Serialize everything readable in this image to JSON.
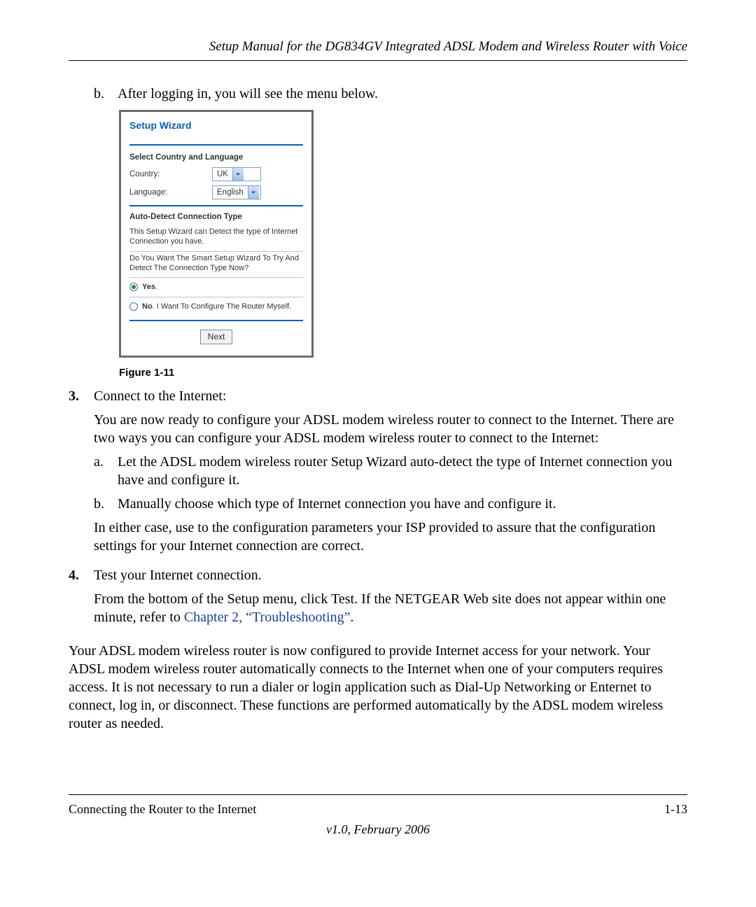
{
  "header": {
    "title": "Setup Manual for the DG834GV Integrated ADSL Modem and Wireless Router with Voice"
  },
  "step_b": {
    "marker": "b.",
    "text": "After logging in, you will see the menu below."
  },
  "wizard": {
    "title": "Setup Wizard",
    "section1_heading": "Select Country and Language",
    "country_label": "Country:",
    "country_value": "UK",
    "language_label": "Language:",
    "language_value": "English",
    "section2_heading": "Auto-Detect Connection Type",
    "detect_desc": "This Setup Wizard can Detect the type of Internet Connection you have.",
    "detect_question": "Do You Want The Smart Setup Wizard To Try And Detect The Connection Type Now?",
    "radio_yes_bold": "Yes",
    "radio_yes_period": ".",
    "radio_no_bold": "No",
    "radio_no_rest": ". I Want To Configure The Router Myself.",
    "next_label": "Next"
  },
  "figure_caption": "Figure 1-11",
  "step3": {
    "marker": "3.",
    "title": "Connect to the Internet:",
    "p1": "You are now ready to configure your ADSL modem wireless router to connect to the Internet. There are two ways you can configure your ADSL modem wireless router to connect to the Internet:",
    "a_marker": "a.",
    "a_text": "Let the ADSL modem wireless router Setup Wizard auto-detect the type of Internet connection you have and configure it.",
    "b_marker": "b.",
    "b_text": "Manually choose which type of Internet connection you have and configure it.",
    "p2": "In either case, use to the configuration parameters your ISP provided to assure that the configuration settings for your Internet connection are correct."
  },
  "step4": {
    "marker": "4.",
    "title": "Test your Internet connection.",
    "p1_a": "From the bottom of the Setup menu, click Test. If the NETGEAR Web site does not appear within one minute, refer to ",
    "link": "Chapter 2, “Troubleshooting”",
    "p1_b": "."
  },
  "closing": "Your ADSL modem wireless router is now configured to provide Internet access for your network. Your ADSL modem wireless router automatically connects to the Internet when one of your computers requires access. It is not necessary to run a dialer or login application such as Dial-Up Networking or Enternet to connect, log in, or disconnect. These functions are performed automatically by the ADSL modem wireless router as needed.",
  "footer": {
    "left": "Connecting the Router to the Internet",
    "right": "1-13",
    "version": "v1.0, February 2006"
  }
}
